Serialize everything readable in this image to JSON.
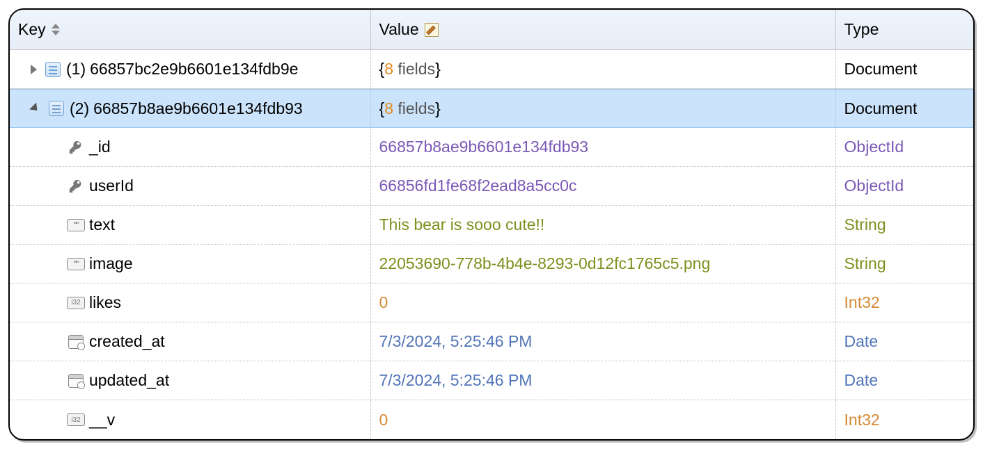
{
  "columns": {
    "key": "Key",
    "value": "Value",
    "type": "Type"
  },
  "docs": [
    {
      "index_label": "(1)",
      "id": "66857bc2e9b6601e134fdb9e",
      "field_count": "8",
      "fields_word": "fields",
      "type": "Document",
      "expanded": false
    },
    {
      "index_label": "(2)",
      "id": "66857b8ae9b6601e134fdb93",
      "field_count": "8",
      "fields_word": "fields",
      "type": "Document",
      "expanded": true,
      "fields": [
        {
          "name": "_id",
          "value": "66857b8ae9b6601e134fdb93",
          "type": "ObjectId",
          "vclass": "oid-purple",
          "tclass": "oid-purple",
          "icon": "key"
        },
        {
          "name": "userId",
          "value": "66856fd1fe68f2ead8a5cc0c",
          "type": "ObjectId",
          "vclass": "oid-purple",
          "tclass": "oid-purple",
          "icon": "key"
        },
        {
          "name": "text",
          "value": "This bear is sooo cute!!",
          "type": "String",
          "vclass": "str-olive",
          "tclass": "str-olive",
          "icon": "str"
        },
        {
          "name": "image",
          "value": "22053690-778b-4b4e-8293-0d12fc1765c5.png",
          "type": "String",
          "vclass": "str-olive",
          "tclass": "str-olive",
          "icon": "str"
        },
        {
          "name": "likes",
          "value": "0",
          "type": "Int32",
          "vclass": "int-orange",
          "tclass": "int-orange",
          "icon": "int"
        },
        {
          "name": "created_at",
          "value": "7/3/2024, 5:25:46 PM",
          "type": "Date",
          "vclass": "date-blue",
          "tclass": "date-blue",
          "icon": "date"
        },
        {
          "name": "updated_at",
          "value": "7/3/2024, 5:25:46 PM",
          "type": "Date",
          "vclass": "date-blue",
          "tclass": "date-blue",
          "icon": "date"
        },
        {
          "name": "__v",
          "value": "0",
          "type": "Int32",
          "vclass": "int-orange",
          "tclass": "int-orange",
          "icon": "int"
        }
      ]
    }
  ]
}
